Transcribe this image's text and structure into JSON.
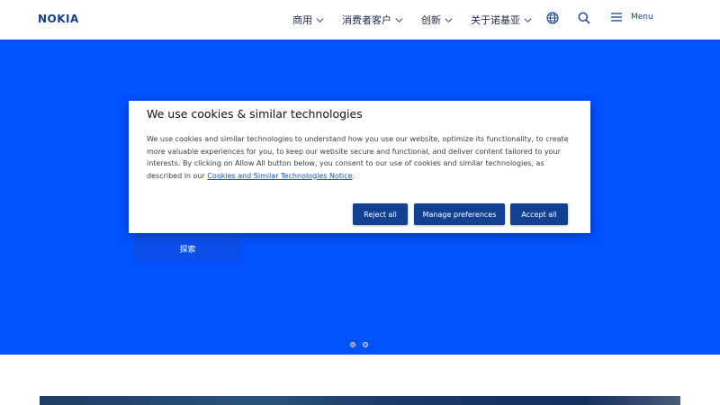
{
  "header": {
    "logo": "NOKIA",
    "nav": [
      {
        "label": "商用"
      },
      {
        "label": "消费者客户"
      },
      {
        "label": "创新"
      },
      {
        "label": "关于诺基亚"
      }
    ],
    "menu_label": "Menu",
    "icons": [
      "globe-icon",
      "search-icon",
      "menu-icon"
    ]
  },
  "hero": {
    "explore_label": "探索",
    "carousel": {
      "slides": 2,
      "active": 1
    },
    "background": "#0052ff"
  },
  "cookie_dialog": {
    "title": "We use cookies & similar technologies",
    "text": "We use cookies and similar technologies to understand how you use our website, optimize its functionality, to create more valuable experiences for you, to keep our website secure and functional, and deliver content tailored to your interests. By clicking on Allow All button below, you consent to our use of cookies and similar technologies, as described in our ",
    "link_text": "Cookies and Similar Technologies Notice",
    "text_end": ".",
    "buttons": {
      "reject": "Reject all",
      "manage": "Manage preferences",
      "accept": "Accept all"
    }
  },
  "colors": {
    "brand": "#124191",
    "hero_blue": "#0052ff",
    "link": "#124dcc"
  }
}
